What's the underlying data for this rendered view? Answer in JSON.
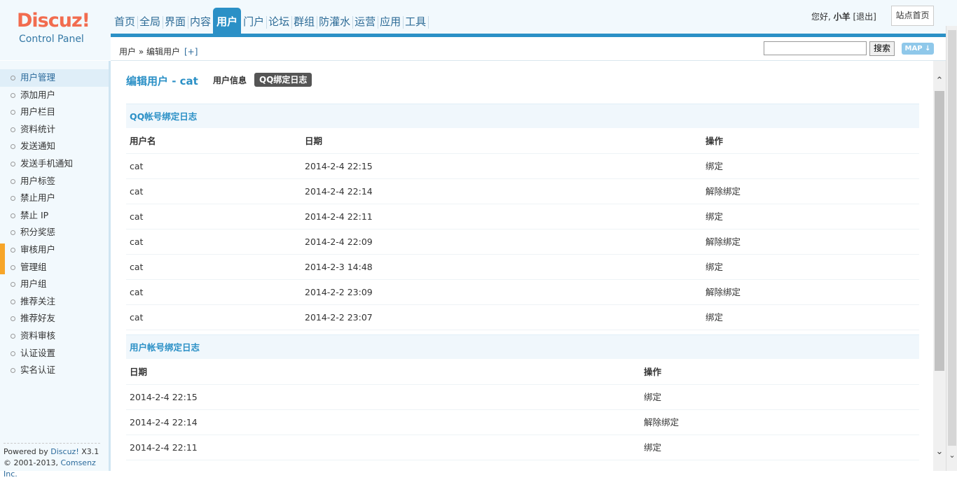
{
  "logo": {
    "brand": "Discuz!",
    "subtitle": "Control Panel"
  },
  "nav": [
    "首页",
    "全局",
    "界面",
    "内容",
    "用户",
    "门户",
    "论坛",
    "群组",
    "防灌水",
    "运营",
    "应用",
    "工具"
  ],
  "nav_active": "用户",
  "user": {
    "greeting": "您好,",
    "name": "小羊",
    "logout": "[退出]",
    "home": "站点首页"
  },
  "breadcrumb": {
    "text": "用户 » 编辑用户",
    "plus": "[+]"
  },
  "search": {
    "button": "搜索",
    "map": "MAP"
  },
  "sidebar": {
    "items": [
      "用户管理",
      "添加用户",
      "用户栏目",
      "资料统计",
      "发送通知",
      "发送手机通知",
      "用户标签",
      "禁止用户",
      "禁止 IP",
      "积分奖惩",
      "审核用户",
      "管理组",
      "用户组",
      "推荐关注",
      "推荐好友",
      "资料审核",
      "认证设置",
      "实名认证"
    ],
    "active": "用户管理"
  },
  "footer": {
    "line1_a": "Powered by ",
    "line1_b": "Discuz!",
    "line1_c": " X3.1",
    "line2_a": "© 2001-2013, ",
    "line2_b": "Comsenz Inc."
  },
  "page": {
    "title": "编辑用户 - cat",
    "tab_info": "用户信息",
    "tab_qq": "QQ绑定日志"
  },
  "qq_section": {
    "title": "QQ帐号绑定日志",
    "headers": [
      "用户名",
      "日期",
      "操作"
    ],
    "rows": [
      [
        "cat",
        "2014-2-4 22:15",
        "绑定"
      ],
      [
        "cat",
        "2014-2-4 22:14",
        "解除绑定"
      ],
      [
        "cat",
        "2014-2-4 22:11",
        "绑定"
      ],
      [
        "cat",
        "2014-2-4 22:09",
        "解除绑定"
      ],
      [
        "cat",
        "2014-2-3 14:48",
        "绑定"
      ],
      [
        "cat",
        "2014-2-2 23:09",
        "解除绑定"
      ],
      [
        "cat",
        "2014-2-2 23:07",
        "绑定"
      ]
    ]
  },
  "user_section": {
    "title": "用户帐号绑定日志",
    "headers": [
      "日期",
      "操作"
    ],
    "rows": [
      [
        "2014-2-4 22:15",
        "绑定"
      ],
      [
        "2014-2-4 22:14",
        "解除绑定"
      ],
      [
        "2014-2-4 22:11",
        "绑定"
      ]
    ]
  },
  "colors": {
    "accent": "#2b90c6",
    "brand": "#f26c4f",
    "sidebar_bg": "#f2f9fd"
  }
}
